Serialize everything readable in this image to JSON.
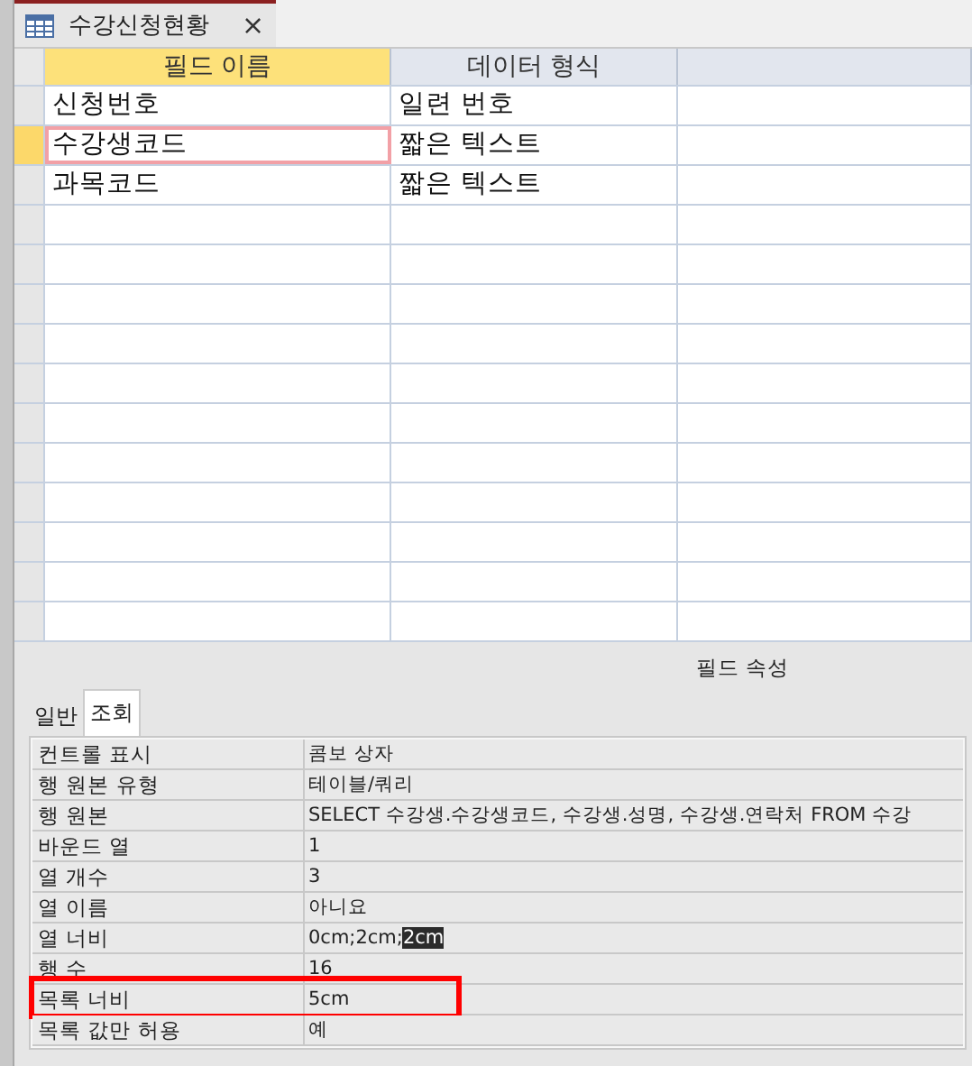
{
  "document_tab": {
    "title": "수강신청현황",
    "close": "×"
  },
  "grid": {
    "columns": [
      {
        "label": "필드 이름",
        "selected": true
      },
      {
        "label": "데이터 형식",
        "selected": false
      },
      {
        "selected": false
      }
    ],
    "rows": [
      {
        "field_name": "신청번호",
        "data_type": "일련 번호",
        "current": false
      },
      {
        "field_name": "수강생코드",
        "data_type": "짧은 텍스트",
        "current": true
      },
      {
        "field_name": "과목코드",
        "data_type": "짧은 텍스트",
        "current": false
      }
    ]
  },
  "field_properties": {
    "title": "필드 속성",
    "tabs": [
      {
        "label": "일반",
        "selected": false
      },
      {
        "label": "조회",
        "selected": true
      }
    ],
    "rows": [
      {
        "name": "컨트롤 표시",
        "value": [
          {
            "text": "콤보 상자",
            "selected": false
          }
        ],
        "highlighted": false
      },
      {
        "name": "행 원본 유형",
        "value": [
          {
            "text": "테이블/쿼리",
            "selected": false
          }
        ],
        "highlighted": false
      },
      {
        "name": "행 원본",
        "value": [
          {
            "text": "SELECT 수강생.수강생코드, 수강생.성명, 수강생.연락처 FROM 수강",
            "selected": false
          }
        ],
        "highlighted": false
      },
      {
        "name": "바운드 열",
        "value": [
          {
            "text": "1",
            "selected": false
          }
        ],
        "highlighted": false
      },
      {
        "name": "열 개수",
        "value": [
          {
            "text": "3",
            "selected": false
          }
        ],
        "highlighted": false
      },
      {
        "name": "열 이름",
        "value": [
          {
            "text": "아니요",
            "selected": false
          }
        ],
        "highlighted": false
      },
      {
        "name": "열 너비",
        "value": [
          {
            "text": "0cm;2cm;",
            "selected": false
          },
          {
            "text": "2cm",
            "selected": true
          }
        ],
        "highlighted": false
      },
      {
        "name": "행 수",
        "value": [
          {
            "text": "16",
            "selected": false
          }
        ],
        "highlighted": false
      },
      {
        "name": "목록 너비",
        "value": [
          {
            "text": "5cm",
            "selected": false
          }
        ],
        "highlighted": true
      },
      {
        "name": "목록 값만 허용",
        "value": [
          {
            "text": "예",
            "selected": false
          }
        ],
        "highlighted": false
      }
    ]
  }
}
